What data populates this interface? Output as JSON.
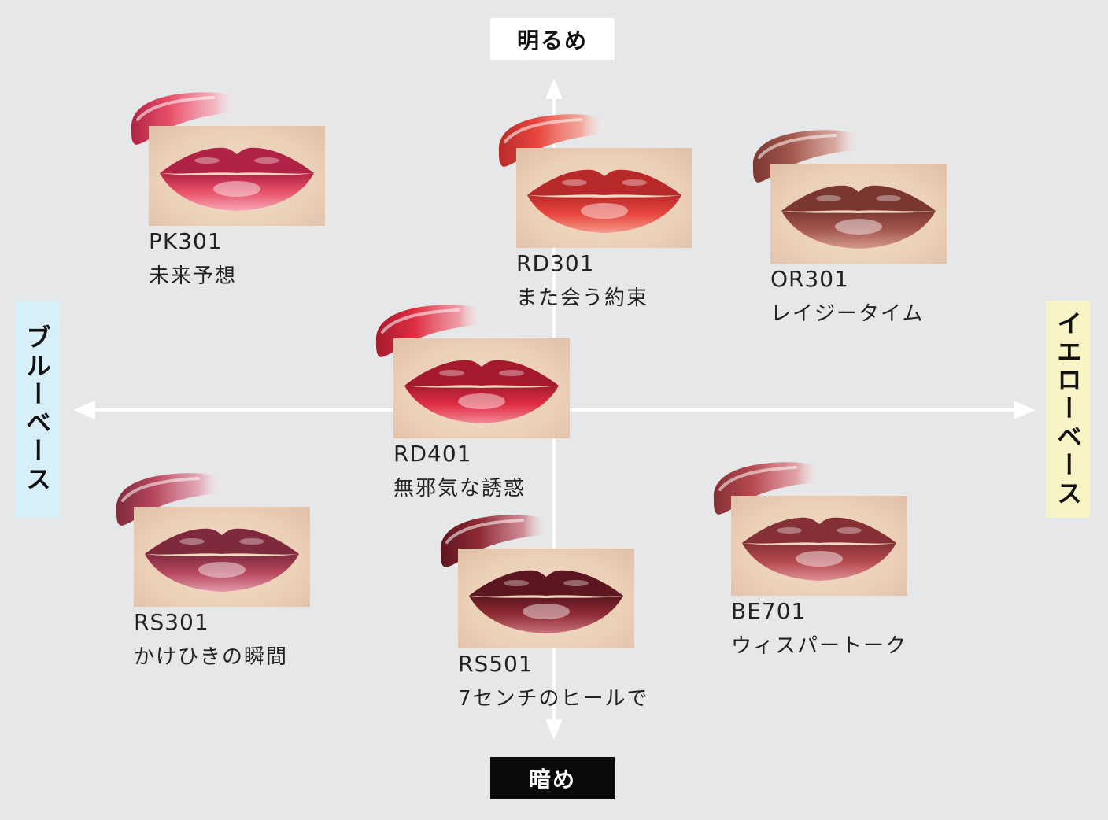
{
  "axes": {
    "top": "明るめ",
    "bottom": "暗め",
    "left": "ブルーベース",
    "right": "イエローベース"
  },
  "items": [
    {
      "code": "PK301",
      "name": "未来予想",
      "color": "#e9506a",
      "dark": "#b02344",
      "light": "#f7a8b5"
    },
    {
      "code": "RD301",
      "name": "また会う約束",
      "color": "#e8463e",
      "dark": "#b82a2a",
      "light": "#f59a8c"
    },
    {
      "code": "OR301",
      "name": "レイジータイム",
      "color": "#a4574f",
      "dark": "#7a3731",
      "light": "#d49a8e"
    },
    {
      "code": "RD401",
      "name": "無邪気な誘惑",
      "color": "#df2e43",
      "dark": "#a51a2e",
      "light": "#f18a97"
    },
    {
      "code": "RS301",
      "name": "かけひきの瞬間",
      "color": "#b8485e",
      "dark": "#7f2a3c",
      "light": "#e29aaa"
    },
    {
      "code": "RS501",
      "name": "7センチのヒールで",
      "color": "#8f2a35",
      "dark": "#5d1620",
      "light": "#c87580"
    },
    {
      "code": "BE701",
      "name": "ウィスパートーク",
      "color": "#b54a50",
      "dark": "#843036",
      "light": "#de9096"
    }
  ]
}
